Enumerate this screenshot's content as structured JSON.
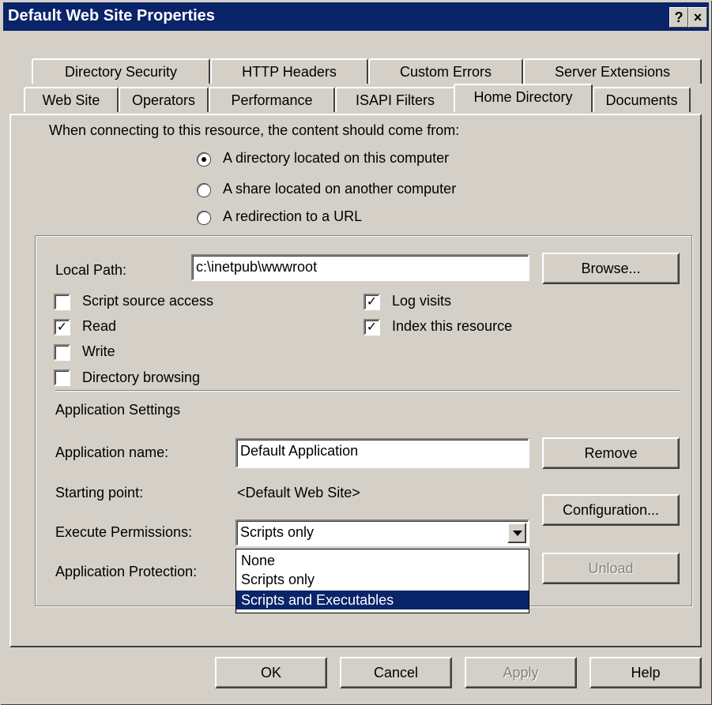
{
  "window": {
    "title": "Default Web Site Properties",
    "help_button": "?",
    "close_button": "×"
  },
  "tabs": {
    "row1": [
      "Directory Security",
      "HTTP Headers",
      "Custom Errors",
      "Server Extensions"
    ],
    "row2": [
      "Web Site",
      "Operators",
      "Performance",
      "ISAPI Filters",
      "Home Directory",
      "Documents"
    ],
    "active": "Home Directory"
  },
  "content_source": {
    "heading": "When connecting to this resource, the content should come from:",
    "options": [
      {
        "label": "A directory located on this computer",
        "checked": true
      },
      {
        "label": "A share located on another computer",
        "checked": false
      },
      {
        "label": "A redirection to a URL",
        "checked": false
      }
    ]
  },
  "local_path": {
    "label": "Local Path:",
    "value": "c:\\inetpub\\wwwroot",
    "browse_label": "Browse..."
  },
  "permissions": [
    {
      "label": "Script source access",
      "checked": false
    },
    {
      "label": "Read",
      "checked": true
    },
    {
      "label": "Write",
      "checked": false
    },
    {
      "label": "Directory browsing",
      "checked": false
    },
    {
      "label": "Log visits",
      "checked": true
    },
    {
      "label": "Index this resource",
      "checked": true
    }
  ],
  "app_settings": {
    "heading": "Application Settings",
    "name_label": "Application name:",
    "name_value": "Default Application",
    "remove_label": "Remove",
    "starting_label": "Starting point:",
    "starting_value": "<Default Web Site>",
    "config_label": "Configuration...",
    "exec_label": "Execute Permissions:",
    "exec_value": "Scripts only",
    "protection_label": "Application Protection:",
    "unload_label": "Unload",
    "exec_options": [
      "None",
      "Scripts only",
      "Scripts and Executables"
    ],
    "exec_highlighted": "Scripts and Executables"
  },
  "buttons": {
    "ok": "OK",
    "cancel": "Cancel",
    "apply": "Apply",
    "help": "Help"
  },
  "colors": {
    "titlebar": "#0a246a",
    "face": "#d4d0c8",
    "highlight": "#0a246a"
  }
}
